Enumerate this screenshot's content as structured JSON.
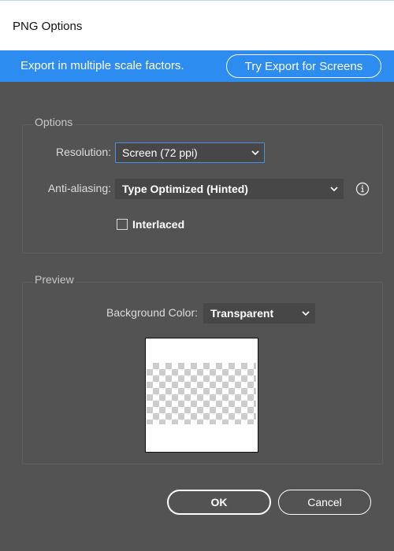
{
  "window": {
    "title": "PNG Options"
  },
  "banner": {
    "text": "Export in multiple scale factors.",
    "button_label": "Try Export for Screens",
    "color": "#2d8cf0"
  },
  "options": {
    "group_label": "Options",
    "resolution_label": "Resolution:",
    "resolution_value": "Screen (72 ppi)",
    "antialiasing_label": "Anti-aliasing:",
    "antialiasing_value": "Type Optimized (Hinted)",
    "interlaced_label": "Interlaced",
    "interlaced_checked": false
  },
  "preview": {
    "group_label": "Preview",
    "background_label": "Background Color:",
    "background_value": "Transparent"
  },
  "actions": {
    "ok_label": "OK",
    "cancel_label": "Cancel"
  },
  "icons": {
    "dropdown": "chevron-down-icon",
    "info": "info-icon"
  }
}
